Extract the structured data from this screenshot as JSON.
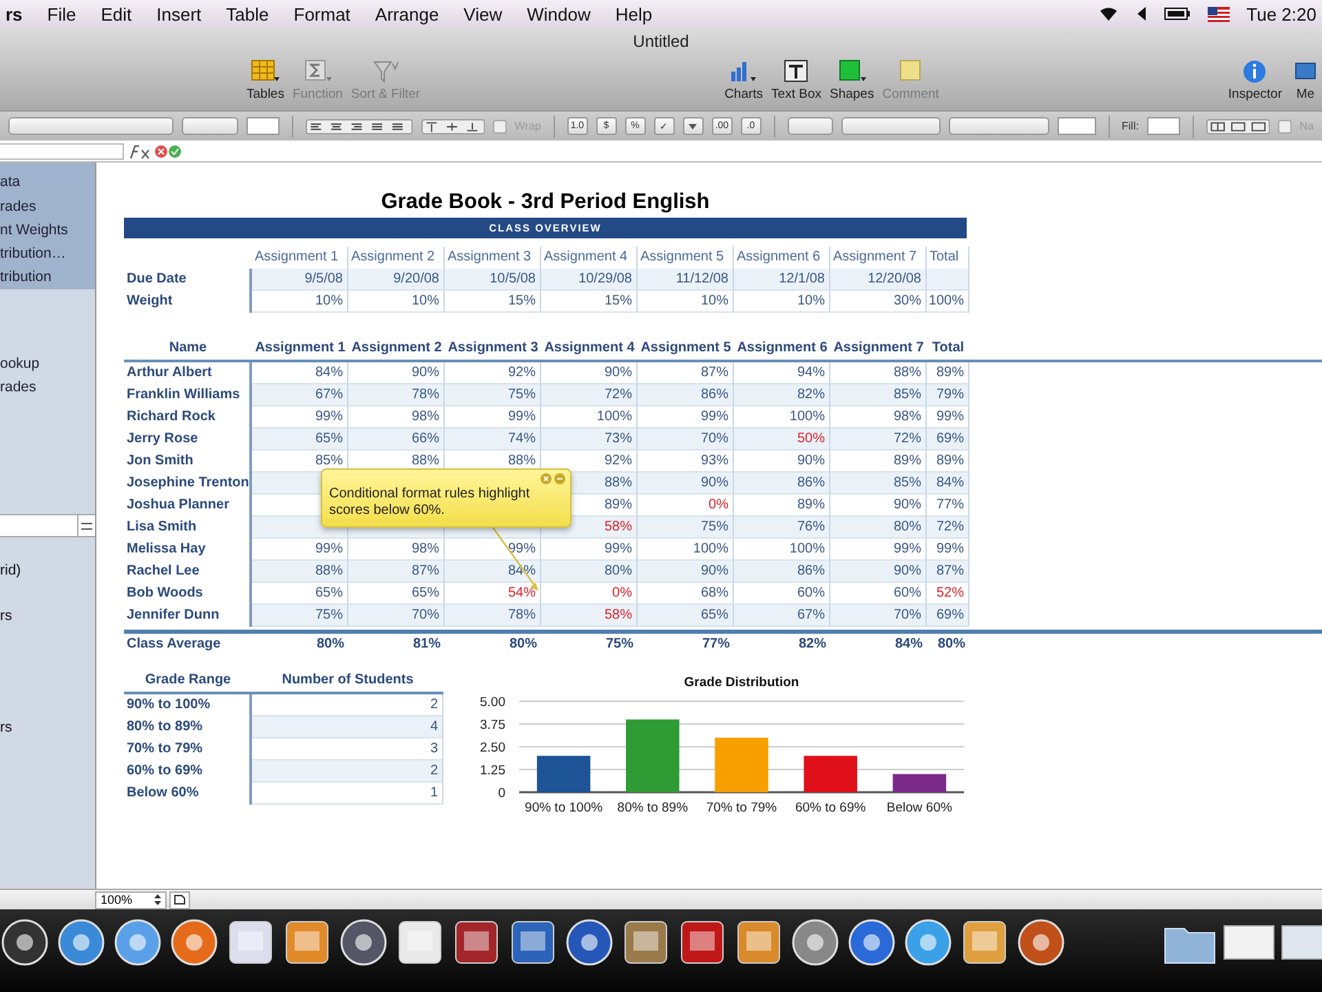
{
  "menu_bar": {
    "items": [
      "rs",
      "File",
      "Edit",
      "Insert",
      "Table",
      "Format",
      "Arrange",
      "View",
      "Window",
      "Help"
    ],
    "clock": "Tue 2:20"
  },
  "window": {
    "title": "Untitled"
  },
  "toolbar": {
    "items": [
      {
        "kind": "tables",
        "label": "Tables",
        "disabled": false
      },
      {
        "kind": "function",
        "label": "Function",
        "disabled": true
      },
      {
        "kind": "sort",
        "label": "Sort & Filter",
        "disabled": true
      },
      {
        "kind": "charts",
        "label": "Charts",
        "disabled": false
      },
      {
        "kind": "textbox",
        "label": "Text Box",
        "disabled": false
      },
      {
        "kind": "shapes",
        "label": "Shapes",
        "disabled": false
      },
      {
        "kind": "comment",
        "label": "Comment",
        "disabled": true
      },
      {
        "kind": "inspector",
        "label": "Inspector",
        "disabled": false
      },
      {
        "kind": "media",
        "label": "Me",
        "disabled": false
      }
    ]
  },
  "format_bar": {
    "wrap": {
      "label": "Wrap",
      "checked": false
    },
    "number_buttons": [
      "1.0",
      "$",
      "%",
      "✓"
    ],
    "decimal_buttons": [
      ".00",
      ".0"
    ],
    "fill_label": "Fill:",
    "name": {
      "label": "Na",
      "checked": false
    }
  },
  "sidebar": {
    "sheets": [
      {
        "label": "ata",
        "selected": true
      },
      {
        "label": "rades",
        "selected": true
      },
      {
        "label": "nt Weights",
        "selected": true
      },
      {
        "label": "tribution…",
        "selected": true
      },
      {
        "label": "tribution",
        "selected": true
      },
      {
        "label": "ookup",
        "selected": false
      },
      {
        "label": "rades",
        "selected": false
      }
    ],
    "styles": [
      "rid)",
      "rs",
      "rs"
    ]
  },
  "sheet": {
    "title": "Grade Book - 3rd Period English",
    "band": "CLASS OVERVIEW",
    "overview": {
      "columns": [
        "",
        "Assignment 1",
        "Assignment 2",
        "Assignment 3",
        "Assignment 4",
        "Assignment 5",
        "Assignment 6",
        "Assignment 7",
        "Total"
      ],
      "rows": [
        {
          "cells": [
            "Due Date",
            "9/5/08",
            "9/20/08",
            "10/5/08",
            "10/29/08",
            "11/12/08",
            "12/1/08",
            "12/20/08",
            ""
          ]
        },
        {
          "cells": [
            "Weight",
            "10%",
            "10%",
            "15%",
            "15%",
            "10%",
            "10%",
            "30%",
            "100%"
          ]
        }
      ]
    },
    "grades": {
      "columns": [
        "Name",
        "Assignment 1",
        "Assignment 2",
        "Assignment 3",
        "Assignment 4",
        "Assignment 5",
        "Assignment 6",
        "Assignment 7",
        "Total"
      ],
      "rows": [
        {
          "cells": [
            {
              "text": "Arthur Albert",
              "low": false
            },
            {
              "text": "84%",
              "low": false
            },
            {
              "text": "90%",
              "low": false
            },
            {
              "text": "92%",
              "low": false
            },
            {
              "text": "90%",
              "low": false
            },
            {
              "text": "87%",
              "low": false
            },
            {
              "text": "94%",
              "low": false
            },
            {
              "text": "88%",
              "low": false
            },
            {
              "text": "89%",
              "low": false
            }
          ]
        },
        {
          "cells": [
            {
              "text": "Franklin Williams",
              "low": false
            },
            {
              "text": "67%",
              "low": false
            },
            {
              "text": "78%",
              "low": false
            },
            {
              "text": "75%",
              "low": false
            },
            {
              "text": "72%",
              "low": false
            },
            {
              "text": "86%",
              "low": false
            },
            {
              "text": "82%",
              "low": false
            },
            {
              "text": "85%",
              "low": false
            },
            {
              "text": "79%",
              "low": false
            }
          ]
        },
        {
          "cells": [
            {
              "text": "Richard Rock",
              "low": false
            },
            {
              "text": "99%",
              "low": false
            },
            {
              "text": "98%",
              "low": false
            },
            {
              "text": "99%",
              "low": false
            },
            {
              "text": "100%",
              "low": false
            },
            {
              "text": "99%",
              "low": false
            },
            {
              "text": "100%",
              "low": false
            },
            {
              "text": "98%",
              "low": false
            },
            {
              "text": "99%",
              "low": false
            }
          ]
        },
        {
          "cells": [
            {
              "text": "Jerry Rose",
              "low": false
            },
            {
              "text": "65%",
              "low": false
            },
            {
              "text": "66%",
              "low": false
            },
            {
              "text": "74%",
              "low": false
            },
            {
              "text": "73%",
              "low": false
            },
            {
              "text": "70%",
              "low": false
            },
            {
              "text": "50%",
              "low": true
            },
            {
              "text": "72%",
              "low": false
            },
            {
              "text": "69%",
              "low": false
            }
          ]
        },
        {
          "cells": [
            {
              "text": "Jon Smith",
              "low": false
            },
            {
              "text": "85%",
              "low": false
            },
            {
              "text": "88%",
              "low": false
            },
            {
              "text": "88%",
              "low": false
            },
            {
              "text": "92%",
              "low": false
            },
            {
              "text": "93%",
              "low": false
            },
            {
              "text": "90%",
              "low": false
            },
            {
              "text": "89%",
              "low": false
            },
            {
              "text": "89%",
              "low": false
            }
          ]
        },
        {
          "cells": [
            {
              "text": "Josephine Trenton",
              "low": false
            },
            null,
            null,
            null,
            {
              "text": "88%",
              "low": false
            },
            {
              "text": "90%",
              "low": false
            },
            {
              "text": "86%",
              "low": false
            },
            {
              "text": "85%",
              "low": false
            },
            {
              "text": "84%",
              "low": false
            }
          ]
        },
        {
          "cells": [
            {
              "text": "Joshua Planner",
              "low": false
            },
            null,
            null,
            null,
            {
              "text": "89%",
              "low": false
            },
            {
              "text": "0%",
              "low": true
            },
            {
              "text": "89%",
              "low": false
            },
            {
              "text": "90%",
              "low": false
            },
            {
              "text": "77%",
              "low": false
            }
          ]
        },
        {
          "cells": [
            {
              "text": "Lisa Smith",
              "low": false
            },
            null,
            null,
            null,
            {
              "text": "58%",
              "low": true
            },
            {
              "text": "75%",
              "low": false
            },
            {
              "text": "76%",
              "low": false
            },
            {
              "text": "80%",
              "low": false
            },
            {
              "text": "72%",
              "low": false
            }
          ]
        },
        {
          "cells": [
            {
              "text": "Melissa Hay",
              "low": false
            },
            {
              "text": "99%",
              "low": false
            },
            {
              "text": "98%",
              "low": false
            },
            {
              "text": "99%",
              "low": false
            },
            {
              "text": "99%",
              "low": false
            },
            {
              "text": "100%",
              "low": false
            },
            {
              "text": "100%",
              "low": false
            },
            {
              "text": "99%",
              "low": false
            },
            {
              "text": "99%",
              "low": false
            }
          ]
        },
        {
          "cells": [
            {
              "text": "Rachel Lee",
              "low": false
            },
            {
              "text": "88%",
              "low": false
            },
            {
              "text": "87%",
              "low": false
            },
            {
              "text": "84%",
              "low": false
            },
            {
              "text": "80%",
              "low": false
            },
            {
              "text": "90%",
              "low": false
            },
            {
              "text": "86%",
              "low": false
            },
            {
              "text": "90%",
              "low": false
            },
            {
              "text": "87%",
              "low": false
            }
          ]
        },
        {
          "cells": [
            {
              "text": "Bob Woods",
              "low": false
            },
            {
              "text": "65%",
              "low": false
            },
            {
              "text": "65%",
              "low": false
            },
            {
              "text": "54%",
              "low": true
            },
            {
              "text": "0%",
              "low": true
            },
            {
              "text": "68%",
              "low": false
            },
            {
              "text": "60%",
              "low": false
            },
            {
              "text": "60%",
              "low": false
            },
            {
              "text": "52%",
              "low": true
            }
          ]
        },
        {
          "cells": [
            {
              "text": "Jennifer Dunn",
              "low": false
            },
            {
              "text": "75%",
              "low": false
            },
            {
              "text": "70%",
              "low": false
            },
            {
              "text": "78%",
              "low": false
            },
            {
              "text": "58%",
              "low": true
            },
            {
              "text": "65%",
              "low": false
            },
            {
              "text": "67%",
              "low": false
            },
            {
              "text": "70%",
              "low": false
            },
            {
              "text": "69%",
              "low": false
            }
          ]
        }
      ],
      "average": {
        "cells": [
          "Class Average",
          "80%",
          "81%",
          "80%",
          "75%",
          "77%",
          "82%",
          "84%",
          "80%"
        ]
      }
    },
    "callout": {
      "text": "Conditional format rules highlight scores below 60%."
    },
    "distribution": {
      "columns": [
        "Grade Range",
        "Number of Students"
      ],
      "rows": [
        {
          "range": "90% to 100%",
          "count": "2"
        },
        {
          "range": "80% to 89%",
          "count": "4"
        },
        {
          "range": "70% to 79%",
          "count": "3"
        },
        {
          "range": "60% to 69%",
          "count": "2"
        },
        {
          "range": "Below 60%",
          "count": "1"
        }
      ]
    },
    "chart_data": {
      "type": "bar",
      "title": "Grade Distribution",
      "stacked": true,
      "grid": true,
      "series": [
        {
          "name": "90% to 100%",
          "color": "#1c5495",
          "values": [
            2,
            null,
            null,
            null,
            null
          ]
        },
        {
          "name": "80% to 89%",
          "color": "#2e9b34",
          "values": [
            null,
            4,
            null,
            null,
            null
          ]
        },
        {
          "name": "70% to 79%",
          "color": "#f7a000",
          "values": [
            null,
            null,
            3,
            null,
            null
          ]
        },
        {
          "name": "60% to 69%",
          "color": "#e0101a",
          "values": [
            null,
            null,
            null,
            2,
            null
          ]
        },
        {
          "name": "Below 60%",
          "color": "#7b2a8a",
          "values": [
            null,
            null,
            null,
            null,
            1
          ]
        }
      ],
      "ylim": [
        0,
        5
      ],
      "yticks": [
        {
          "value": 0,
          "label": "0"
        },
        {
          "value": 1.25,
          "label": "1.25"
        },
        {
          "value": 2.5,
          "label": "2.50"
        },
        {
          "value": 3.75,
          "label": "3.75"
        },
        {
          "value": 5,
          "label": "5.00"
        }
      ]
    }
  },
  "status_bar": {
    "zoom": "100%"
  }
}
